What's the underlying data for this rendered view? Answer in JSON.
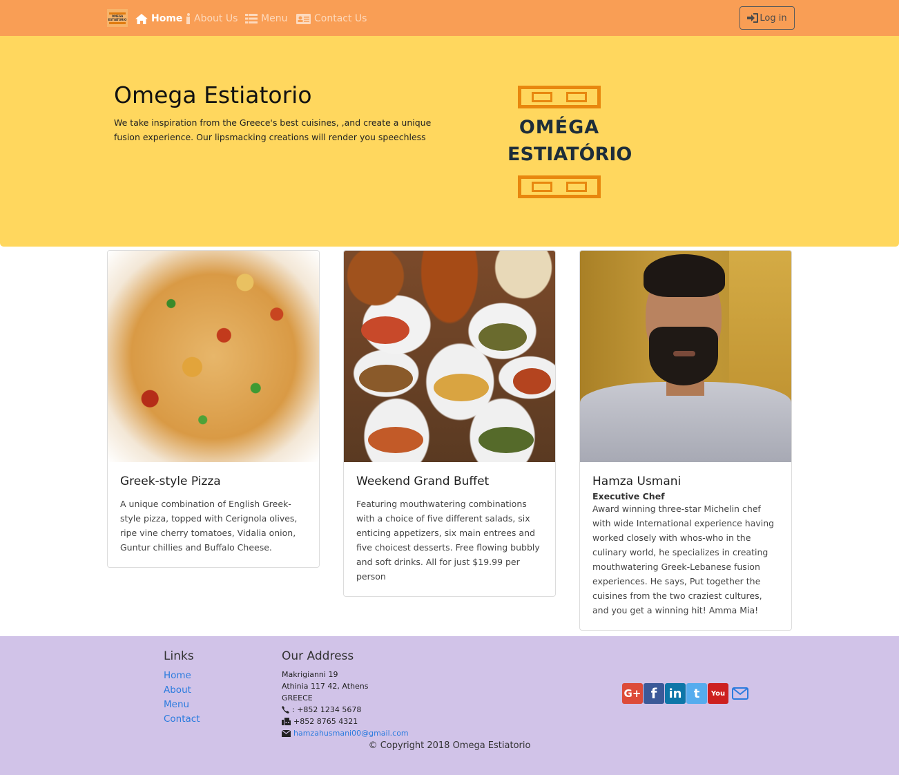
{
  "navbar": {
    "brand_icon": "omega-estiatorio-logo-icon",
    "items": [
      {
        "label": "Home",
        "icon": "home-icon",
        "active": true
      },
      {
        "label": "About Us",
        "icon": "info-icon",
        "active": false
      },
      {
        "label": "Menu",
        "icon": "list-icon",
        "active": false
      },
      {
        "label": "Contact Us",
        "icon": "address-card-icon",
        "active": false
      }
    ],
    "login_label": "Log in",
    "login_icon": "sign-in-icon"
  },
  "hero": {
    "title": "Omega Estiatorio",
    "text": "We take inspiration from the Greece's best cuisines, ,and create a unique fusion experience. Our lipsmacking creations will render you speechless",
    "logo_line1": "OMÉGA",
    "logo_line2": "ESTIATÓRIO"
  },
  "cards": [
    {
      "image": "greek-style-pizza-photo",
      "title": "Greek-style Pizza",
      "subtitle": "",
      "text": "A unique combination of English Greek-style pizza, topped with Cerignola olives, ripe vine cherry tomatoes, Vidalia onion, Guntur chillies and Buffalo Cheese."
    },
    {
      "image": "buffet-dishes-photo",
      "title": "Weekend Grand Buffet",
      "subtitle": "",
      "text": "Featuring mouthwatering combinations with a choice of five different salads, six enticing appetizers, six main entrees and five choicest desserts. Free flowing bubbly and soft drinks. All for just $19.99 per person"
    },
    {
      "image": "chef-portrait-photo",
      "title": "Hamza Usmani",
      "subtitle": "Executive Chef",
      "text": "Award winning three-star Michelin chef with wide International experience having worked closely with whos-who in the culinary world, he specializes in creating mouthwatering Greek-Lebanese fusion experiences. He says, Put together the cuisines from the two craziest cultures, and you get a winning hit! Amma Mia!"
    }
  ],
  "footer": {
    "links_heading": "Links",
    "links": [
      "Home",
      "About",
      "Menu",
      "Contact"
    ],
    "address_heading": "Our Address",
    "address_lines": [
      "Makrigianni 19",
      "Athinia 117 42, Athens",
      "GREECE"
    ],
    "phone": ": +852 1234 5678",
    "fax": "+852 8765 4321",
    "email": "hamzahusmani00@gmail.com",
    "social": [
      {
        "name": "google-plus-icon",
        "label": "G+",
        "color": "#dd4b39"
      },
      {
        "name": "facebook-icon",
        "label": "f",
        "color": "#3b5998"
      },
      {
        "name": "linkedin-icon",
        "label": "in",
        "color": "#0e76a8"
      },
      {
        "name": "twitter-icon",
        "label": "t",
        "color": "#55acee"
      },
      {
        "name": "youtube-icon",
        "label": "You",
        "color": "#cd201f"
      },
      {
        "name": "mail-icon",
        "label": "",
        "color": "#2b7bde"
      }
    ],
    "copyright": "© Copyright 2018 Omega Estiatorio"
  },
  "colors": {
    "navbar_bg": "#f99e55",
    "hero_bg": "#ffd75e",
    "footer_bg": "#d1c3e8",
    "link": "#2b7bde"
  }
}
